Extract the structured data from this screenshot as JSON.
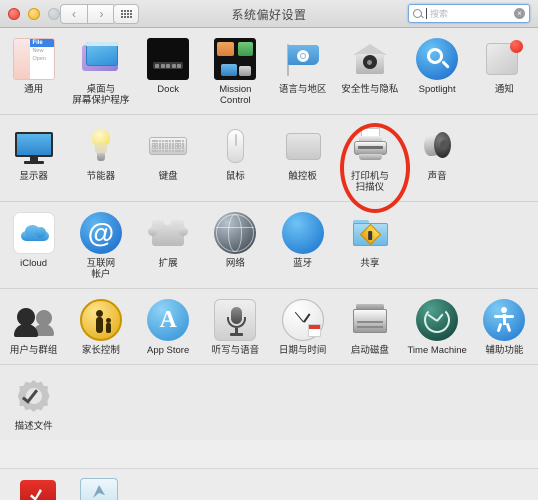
{
  "window": {
    "title": "系统偏好设置",
    "traffic_lights": [
      "close",
      "minimize",
      "zoom-disabled"
    ],
    "nav": {
      "back_label": "‹",
      "forward_label": "›"
    },
    "grid_button_name": "show-all-button"
  },
  "search": {
    "placeholder": "搜索",
    "value": "",
    "clear_label": "×"
  },
  "accent": {
    "highlight_color": "#e8301a",
    "badge_color": "#e02a1c",
    "search_focus_border": "#7aa7dd"
  },
  "annotation": {
    "target": "打印机与扫描仪",
    "shape": "ellipse",
    "color": "#e8301a"
  },
  "sections": [
    {
      "name": "personal",
      "items": [
        {
          "label": "通用",
          "icon": "general-icon"
        },
        {
          "label": "桌面与\n屏幕保护程序",
          "icon": "desktop-screensaver-icon"
        },
        {
          "label": "Dock",
          "icon": "dock-icon"
        },
        {
          "label": "Mission\nControl",
          "icon": "mission-control-icon"
        },
        {
          "label": "语言与地区",
          "icon": "language-region-icon"
        },
        {
          "label": "安全性与隐私",
          "icon": "security-privacy-icon"
        },
        {
          "label": "Spotlight",
          "icon": "spotlight-icon"
        },
        {
          "label": "通知",
          "icon": "notifications-icon",
          "badge": true
        }
      ]
    },
    {
      "name": "hardware",
      "items": [
        {
          "label": "显示器",
          "icon": "displays-icon"
        },
        {
          "label": "节能器",
          "icon": "energy-saver-icon"
        },
        {
          "label": "键盘",
          "icon": "keyboard-icon"
        },
        {
          "label": "鼠标",
          "icon": "mouse-icon"
        },
        {
          "label": "触控板",
          "icon": "trackpad-icon"
        },
        {
          "label": "打印机与\n扫描仪",
          "icon": "printers-scanners-icon",
          "highlighted": true
        },
        {
          "label": "声音",
          "icon": "sound-icon"
        }
      ]
    },
    {
      "name": "internet-wireless",
      "items": [
        {
          "label": "iCloud",
          "icon": "icloud-icon"
        },
        {
          "label": "互联网\n帐户",
          "icon": "internet-accounts-icon"
        },
        {
          "label": "扩展",
          "icon": "extensions-icon"
        },
        {
          "label": "网络",
          "icon": "network-icon"
        },
        {
          "label": "蓝牙",
          "icon": "bluetooth-icon"
        },
        {
          "label": "共享",
          "icon": "sharing-icon"
        }
      ]
    },
    {
      "name": "system",
      "items": [
        {
          "label": "用户与群组",
          "icon": "users-groups-icon"
        },
        {
          "label": "家长控制",
          "icon": "parental-controls-icon"
        },
        {
          "label": "App Store",
          "icon": "app-store-icon"
        },
        {
          "label": "听写与语音",
          "icon": "dictation-speech-icon"
        },
        {
          "label": "日期与时间",
          "icon": "date-time-icon"
        },
        {
          "label": "启动磁盘",
          "icon": "startup-disk-icon"
        },
        {
          "label": "Time Machine",
          "icon": "time-machine-icon"
        },
        {
          "label": "辅助功能",
          "icon": "accessibility-icon"
        }
      ]
    },
    {
      "name": "other",
      "items": [
        {
          "label": "描述文件",
          "icon": "profiles-icon"
        }
      ]
    }
  ],
  "desktop_strip": {
    "icons": [
      {
        "name": "red-app-icon"
      },
      {
        "name": "preview-app-icon"
      }
    ]
  }
}
